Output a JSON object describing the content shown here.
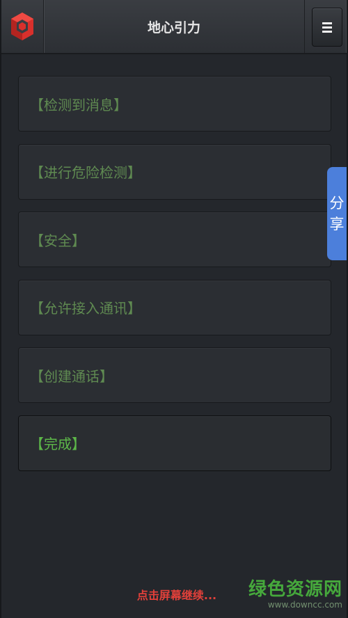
{
  "header": {
    "title": "地心引力",
    "logo_icon": "cube-logo-icon",
    "menu_icon": "hamburger-menu-icon"
  },
  "steps": [
    {
      "label": "【检测到消息】",
      "state": "dim"
    },
    {
      "label": "【进行危险检测】",
      "state": "dim"
    },
    {
      "label": "【安全】",
      "state": "dim"
    },
    {
      "label": "【允许接入通讯】",
      "state": "dim"
    },
    {
      "label": "【创建通话】",
      "state": "dim"
    },
    {
      "label": "【完成】",
      "state": "active"
    }
  ],
  "share_tab": {
    "char1": "分",
    "char2": "享"
  },
  "footer": {
    "hint": "点击屏幕继续..."
  },
  "watermark": {
    "brand": "绿色资源网",
    "url": "www.downcc.com"
  },
  "colors": {
    "background": "#24272c",
    "step_dim_text": "#5f8a51",
    "step_active_text": "#5db749",
    "share_tab": "#4c7fdb",
    "footer_hint": "#e2403a",
    "logo_red": "#d9302c"
  }
}
